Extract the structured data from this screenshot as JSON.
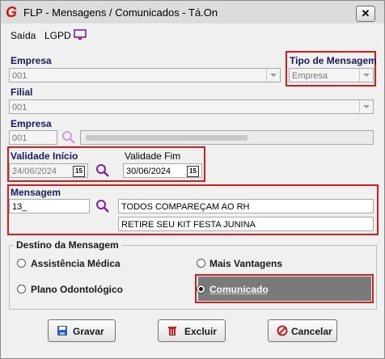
{
  "window": {
    "title": "FLP - Mensagens / Comunicados - Tá.On",
    "close_label": "✕"
  },
  "menu": {
    "items": [
      "Saída",
      "LGPD"
    ]
  },
  "empresa": {
    "label": "Empresa",
    "value": "001"
  },
  "tipo_mensagem": {
    "label": "Tipo de Mensagem",
    "value": "Empresa"
  },
  "filial": {
    "label": "Filial",
    "value": "001"
  },
  "empresa2": {
    "label": "Empresa",
    "value": "001"
  },
  "validade": {
    "inicio_label": "Validade Início",
    "inicio_value": "24/06/2024",
    "fim_label": "Validade Fim",
    "fim_value": "30/06/2024",
    "cal_glyph": "15"
  },
  "mensagem": {
    "label": "Mensagem",
    "code": "13_",
    "line1": "TODOS COMPAREÇAM AO RH",
    "line2": "RETIRE SEU KIT FESTA JUNINA"
  },
  "destino": {
    "title": "Destino da Mensagem",
    "options": [
      "Assistência Médica",
      "Mais Vantagens",
      "Plano Odontológico",
      "Comunicado"
    ],
    "selected": "Comunicado"
  },
  "buttons": {
    "gravar": "Gravar",
    "excluir": "Excluir",
    "cancelar": "Cancelar"
  },
  "colors": {
    "highlight_border": "#d41e1e",
    "label_blue": "#1a1a5a",
    "search_icon": "#7a1fa2",
    "selected_option_bg": "#7a7a7a"
  }
}
